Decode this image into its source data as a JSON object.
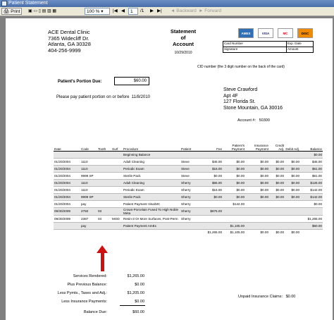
{
  "window": {
    "title": "Patient Statement"
  },
  "toolbar": {
    "print_label": "Print",
    "zoom_value": "100 %",
    "page_value": "1",
    "page_total": "/1",
    "back_label": "Backward",
    "forward_label": "Forward"
  },
  "clinic": {
    "name": "ACE Dental Clinic",
    "street": "7365 Widecliff Dr.",
    "city_state_zip": "Atlanta, GA  30328",
    "phone": "404-256-9999"
  },
  "statement": {
    "title_line1": "Statement",
    "title_line2": "of",
    "title_line3": "Account",
    "date": "10/29/2010"
  },
  "cards": [
    "AMEX",
    "VISA",
    "MC",
    "DISC"
  ],
  "card_form": {
    "card_number": "Card Number",
    "exp_date": "Exp. Date",
    "signature": "Signature",
    "amount": "Amount",
    "cid_note": "CID number (the 3 digit number on the back of the card)"
  },
  "due": {
    "label": "Patient's Portion Due:",
    "amount": "$60.00",
    "note_prefix": "Please pay patient portion on or before",
    "note_date": "11/8/2010"
  },
  "patient": {
    "name": "Steve Crawford",
    "line1": "Apt 4F",
    "line2": "127 Florida St.",
    "line3": "Stone Mountain, GA  30016"
  },
  "account": {
    "label": "Account #:",
    "number": "50300"
  },
  "table": {
    "headers": [
      "Date",
      "Code",
      "Tooth",
      "Surf",
      "Procedure",
      "Patient",
      "Fee",
      "Patient's Payment",
      "Insurance Payment",
      "Credit Adj.",
      "Debit Adj.",
      "Balance"
    ],
    "rows": [
      {
        "date": "",
        "code": "",
        "tooth": "",
        "surf": "",
        "proc": "Beginning Balance",
        "patient": "",
        "fee": "",
        "ppay": "",
        "ipay": "",
        "cadj": "",
        "dadj": "",
        "bal": "$0.00"
      },
      {
        "date": "01/20/2004",
        "code": "1110",
        "tooth": "",
        "surf": "",
        "proc": "Adult Cleaning",
        "patient": "Steve",
        "fee": "$45.00",
        "ppay": "$0.00",
        "ipay": "$0.00",
        "cadj": "$0.00",
        "dadj": "$0.00",
        "bal": "$45.00"
      },
      {
        "date": "01/20/2004",
        "code": "1110",
        "tooth": "",
        "surf": "",
        "proc": "Periodic Exam",
        "patient": "Steve",
        "fee": "$16.00",
        "ppay": "$0.00",
        "ipay": "$0.00",
        "cadj": "$0.00",
        "dadj": "$0.00",
        "bal": "$61.00"
      },
      {
        "date": "01/20/2004",
        "code": "9999 SP",
        "tooth": "",
        "surf": "",
        "proc": "Sterile Pack",
        "patient": "Steve",
        "fee": "$0.00",
        "ppay": "$0.00",
        "ipay": "$0.00",
        "cadj": "$0.00",
        "dadj": "$0.00",
        "bal": "$61.00"
      },
      {
        "date": "01/20/2004",
        "code": "1110",
        "tooth": "",
        "surf": "",
        "proc": "Adult Cleaning",
        "patient": "Sherry",
        "fee": "$65.00",
        "ppay": "$0.00",
        "ipay": "$0.00",
        "cadj": "$0.00",
        "dadj": "$0.00",
        "bal": "$126.00"
      },
      {
        "date": "01/20/2004",
        "code": "1110",
        "tooth": "",
        "surf": "",
        "proc": "Periodic Exam",
        "patient": "Sherry",
        "fee": "$16.00",
        "ppay": "$0.00",
        "ipay": "$0.00",
        "cadj": "$0.00",
        "dadj": "$0.00",
        "bal": "$142.00"
      },
      {
        "date": "01/20/2004",
        "code": "9999 SP",
        "tooth": "",
        "surf": "",
        "proc": "Sterile Pack",
        "patient": "Sherry",
        "fee": "$0.00",
        "ppay": "$0.00",
        "ipay": "$0.00",
        "cadj": "$0.00",
        "dadj": "$0.00",
        "bal": "$142.00"
      },
      {
        "date": "01/20/2004",
        "code": "pay",
        "tooth": "",
        "surf": "",
        "proc": "Patient Payment Visa/MC",
        "patient": "Sherry",
        "fee": "",
        "ppay": "$142.00",
        "ipay": "",
        "cadj": "",
        "dadj": "",
        "bal": "$0.00"
      },
      {
        "date": "09/30/2009",
        "code": "2750",
        "tooth": "03",
        "surf": "",
        "proc": "Crown-Porcelain Fused To High Noble Meta",
        "patient": "Sherry",
        "fee": "$875.00",
        "ppay": "",
        "ipay": "",
        "cadj": "",
        "dadj": "",
        "bal": ""
      },
      {
        "date": "09/30/2009",
        "code": "2387",
        "tooth": "04",
        "surf": "MOD",
        "proc": "Resin-3 Or More Surfaces, Post-Perm",
        "patient": "Sherry",
        "fee": "",
        "ppay": "",
        "ipay": "",
        "cadj": "",
        "dadj": "",
        "bal": "$1,265.00"
      },
      {
        "date": "",
        "code": "pay",
        "tooth": "",
        "surf": "",
        "proc": "Patient Payment AmEx",
        "patient": "",
        "fee": "",
        "ppay": "$1,105.00",
        "ipay": "",
        "cadj": "",
        "dadj": "",
        "bal": "$60.00"
      }
    ],
    "totals": {
      "fee": "$1,265.00",
      "ppay": "$1,105.00",
      "ipay": "$0.00",
      "cadj": "$0.00",
      "dadj": "$0.00"
    }
  },
  "summary": {
    "services_label": "Services Rendered:",
    "services_value": "$1,265.00",
    "previous_label": "Plus Previous Balance:",
    "previous_value": "$0.00",
    "payments_label": "Less Pymts., Taxes and Adj.:",
    "payments_value": "$1,205.00",
    "insurance_label": "Less Insurance Payments:",
    "insurance_value": "$0.00",
    "balance_label": "Balance Due:",
    "balance_value": "$60.00",
    "unpaid_label": "Unpaid Insurance Claims:",
    "unpaid_value": "$0.00"
  },
  "colors": {
    "arrow": "#d01010",
    "titlebar": "#4a6ea9",
    "shade": "#e6e6e6"
  }
}
